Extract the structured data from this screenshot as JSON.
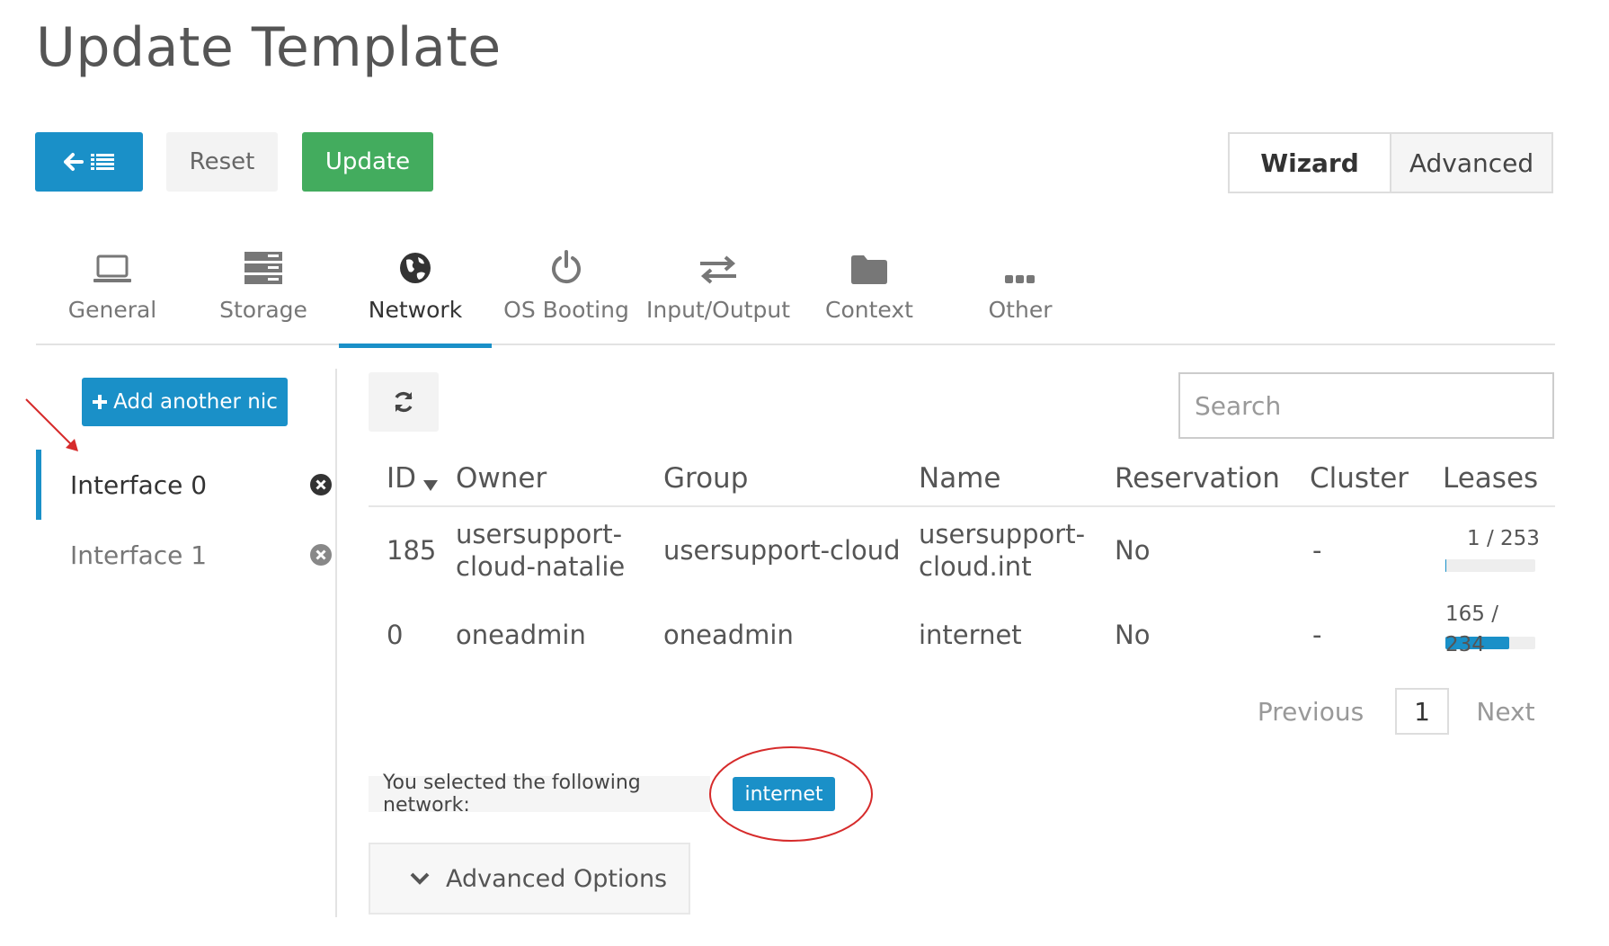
{
  "page": {
    "title": "Update Template"
  },
  "toolbar": {
    "reset_label": "Reset",
    "update_label": "Update",
    "back_icon": "arrow-left-list-icon"
  },
  "mode_switch": {
    "wizard_label": "Wizard",
    "advanced_label": "Advanced",
    "active": "Wizard"
  },
  "tabs": [
    {
      "label": "General",
      "icon": "laptop-icon"
    },
    {
      "label": "Storage",
      "icon": "storage-icon"
    },
    {
      "label": "Network",
      "icon": "globe-icon",
      "active": true
    },
    {
      "label": "OS Booting",
      "icon": "power-icon"
    },
    {
      "label": "Input/Output",
      "icon": "exchange-icon"
    },
    {
      "label": "Context",
      "icon": "folder-icon"
    },
    {
      "label": "Other",
      "icon": "ellipsis-icon"
    }
  ],
  "nics": {
    "add_label": "Add another nic",
    "items": [
      {
        "label": "Interface 0",
        "active": true
      },
      {
        "label": "Interface 1",
        "active": false
      }
    ]
  },
  "search": {
    "placeholder": "Search"
  },
  "table": {
    "columns": [
      "ID",
      "Owner",
      "Group",
      "Name",
      "Reservation",
      "Cluster",
      "Leases"
    ],
    "rows": [
      {
        "id": "185",
        "owner_line1": "usersupport-",
        "owner_line2": "cloud-natalie",
        "group": "usersupport-cloud",
        "name_line1": "usersupport-",
        "name_line2": "cloud.int",
        "reservation": "No",
        "cluster": "-",
        "leases_text": "1 / 253",
        "leases_fraction": 0.004
      },
      {
        "id": "0",
        "owner": "oneadmin",
        "group": "oneadmin",
        "name": "internet",
        "reservation": "No",
        "cluster": "-",
        "leases_line1": "165 /",
        "leases_line2": "234",
        "leases_fraction": 0.705
      }
    ]
  },
  "pagination": {
    "prev_label": "Previous",
    "current_page": "1",
    "next_label": "Next"
  },
  "selection": {
    "text": "You selected the following network:",
    "network": "internet"
  },
  "advanced_options": {
    "label": "Advanced Options"
  },
  "colors": {
    "primary": "#1a90c8",
    "success": "#43ac5e",
    "annotation": "#d62b2b"
  }
}
